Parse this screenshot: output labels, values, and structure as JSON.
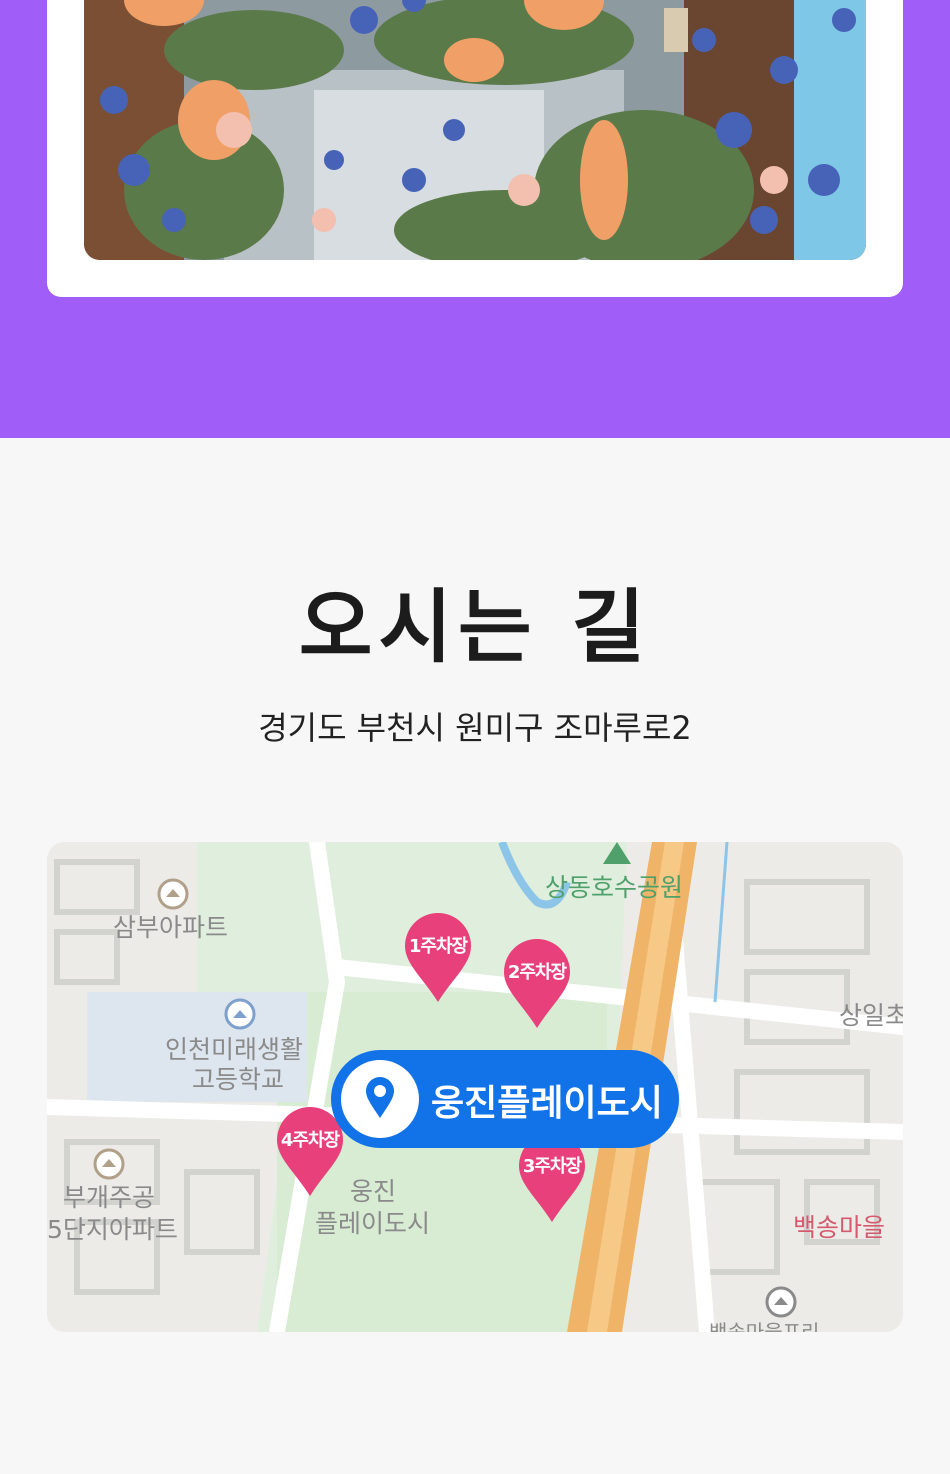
{
  "directions": {
    "title": "오시는 길",
    "address": "경기도 부천시 원미구 조마루로2"
  },
  "map": {
    "place_name": "웅진플레이도시",
    "labels": {
      "sangdong_park": "상동호수공원",
      "sambu_apt": "삼부아파트",
      "incheon_school_line1": "인천미래생활",
      "incheon_school_line2": "고등학교",
      "bugae_apt_line1": "부개주공",
      "bugae_apt_line2": "5단지아파트",
      "woongjin_line1": "웅진",
      "woongjin_line2": "플레이도시",
      "sangil": "상일초",
      "baeksong": "백송마을",
      "baeksong_bottom": "백송마을프리"
    },
    "parking": [
      "1주차장",
      "2주차장",
      "3주차장",
      "4주차장"
    ]
  },
  "colors": {
    "accent_purple": "#a05df7",
    "map_pin_pink": "#e8407a",
    "place_badge_blue": "#1273e8"
  },
  "icons": [
    "location-pin-icon",
    "park-icon",
    "building-icon",
    "school-icon"
  ]
}
